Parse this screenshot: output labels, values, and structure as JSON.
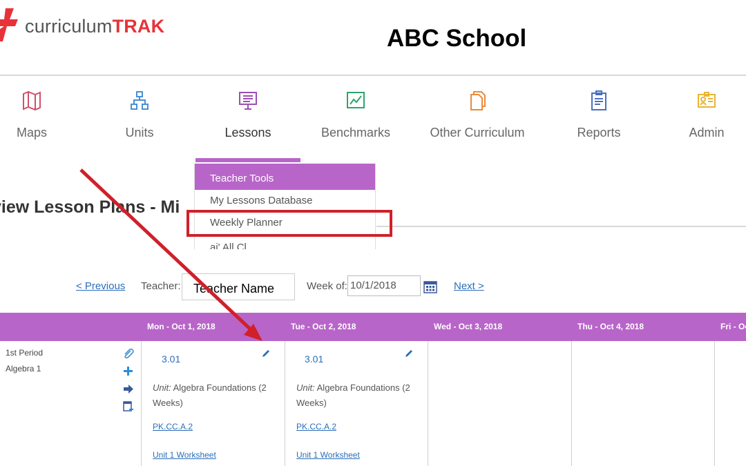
{
  "header": {
    "logo_text_light": "curriculum",
    "logo_text_bold": "TRAK",
    "school_name": "ABC School"
  },
  "nav": [
    {
      "label": "Maps",
      "icon": "map-icon"
    },
    {
      "label": "Units",
      "icon": "sitemap-icon"
    },
    {
      "label": "Lessons",
      "icon": "presentation-icon"
    },
    {
      "label": "Benchmarks",
      "icon": "chart-line-icon"
    },
    {
      "label": "Other Curriculum",
      "icon": "documents-icon"
    },
    {
      "label": "Reports",
      "icon": "clipboard-icon"
    },
    {
      "label": "Admin",
      "icon": "id-card-icon"
    }
  ],
  "dropdown": {
    "header": "Teacher Tools",
    "items": [
      "My Lessons Database",
      "Weekly Planner"
    ],
    "cut_item": "ai'          All Cl"
  },
  "page_title": "view Lesson Plans - Mi",
  "controls": {
    "previous": "< Previous",
    "teacher_label": "Teacher:",
    "teacher_value": "Teacher Name",
    "week_label": "Week of:",
    "week_value": "10/1/2018",
    "next": "Next >"
  },
  "schedule": {
    "days": [
      "Mon - Oct 1, 2018",
      "Tue - Oct 2, 2018",
      "Wed - Oct 3, 2018",
      "Thu - Oct 4, 2018",
      "Fri - Oc"
    ],
    "period": "1st Period",
    "course": "Algebra 1",
    "lessons": [
      {
        "number": "3.01",
        "unit_label": "Unit:",
        "unit_name": "Algebra Foundations (2 Weeks)",
        "standard": "PK.CC.A.2",
        "worksheet": "Unit 1 Worksheet"
      },
      {
        "number": "3.01",
        "unit_label": "Unit:",
        "unit_name": "Algebra Foundations (2 Weeks)",
        "standard": "PK.CC.A.2",
        "worksheet": "Unit 1 Worksheet"
      }
    ]
  },
  "colors": {
    "accent_purple": "#b865c9",
    "annotation_red": "#d0202a",
    "link_blue": "#2a6ebb"
  }
}
